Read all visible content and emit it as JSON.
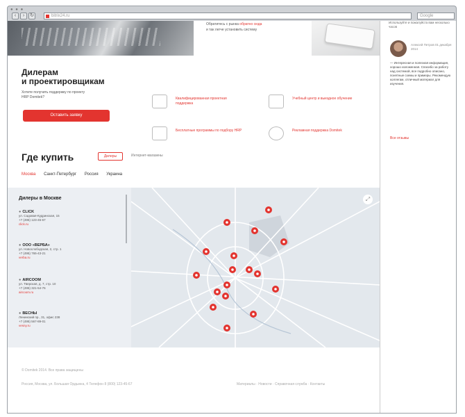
{
  "browser": {
    "address": "bitrix24.ru",
    "search_placeholder": "Google"
  },
  "hero": {
    "line1_prefix": "Обратитесь с рынка ",
    "line1_link": "обратно сюда",
    "line2": "и так легче установить систему"
  },
  "dealers": {
    "title": "Дилерам\nи проектировщикам",
    "description": "Хотите получить поддержку по проекту HRP Domitek?",
    "button": "Оставить заявку",
    "features": [
      {
        "label": "Квалифицированная проектная поддержка"
      },
      {
        "label": "Учебный центр и выездное обучение"
      },
      {
        "label": "Бесплатные программы по подбору HRP"
      },
      {
        "label": "Рекламная поддержка Domitek"
      }
    ]
  },
  "where": {
    "title": "Где купить",
    "tab_active": "Дилеры",
    "tab_other": "Интернет-магазины",
    "cities": [
      "Москва",
      "Санкт-Петербург",
      "Россия",
      "Украина"
    ],
    "active_city": 0
  },
  "list": {
    "title": "Дилеры в  Москве",
    "items": [
      {
        "name": "CLICK",
        "addr": "ул. Садовая-Кудринская, 15",
        "phone": "+7 (495) 123-45-67",
        "link": "click.ru"
      },
      {
        "name": "ООО «ВЕРБА»",
        "addr": "ул. Новослободская, 2, стр. 1",
        "phone": "+7 (495) 765-43-21",
        "link": "verba.ru"
      },
      {
        "name": "AIRCOOM",
        "addr": "ул. Тверская, д. 7, стр. 10",
        "phone": "+7 (495) 321-54-76",
        "link": "aircoom.ru"
      },
      {
        "name": "ВЕСНЫ",
        "addr": "Ленинский пр., 31, офис 238",
        "phone": "+7 (495) 567-89-01",
        "link": "vesny.ru"
      }
    ]
  },
  "footer": {
    "line1": "© Domitek 2014. Все права защищены",
    "line2": "Россия, Москва, ул. Большая Ордынка, 4 Телефон 8 (800) 123-45-67",
    "links": "Материалы · Новости · Справочная служба · Контакты"
  },
  "sidebar": {
    "top": "Используйте и пожалуйста вам несколько часов",
    "author": "Алексей Петров 01 декабря 2014",
    "quote": "— Интересная и полезная информация, хорошо изложенная. Спасибо за работу над системой, все подробно описано, понятные схемы и примеры. Рекомендую коллегам, отличный материал для изучения.",
    "more": "Все отзывы"
  }
}
